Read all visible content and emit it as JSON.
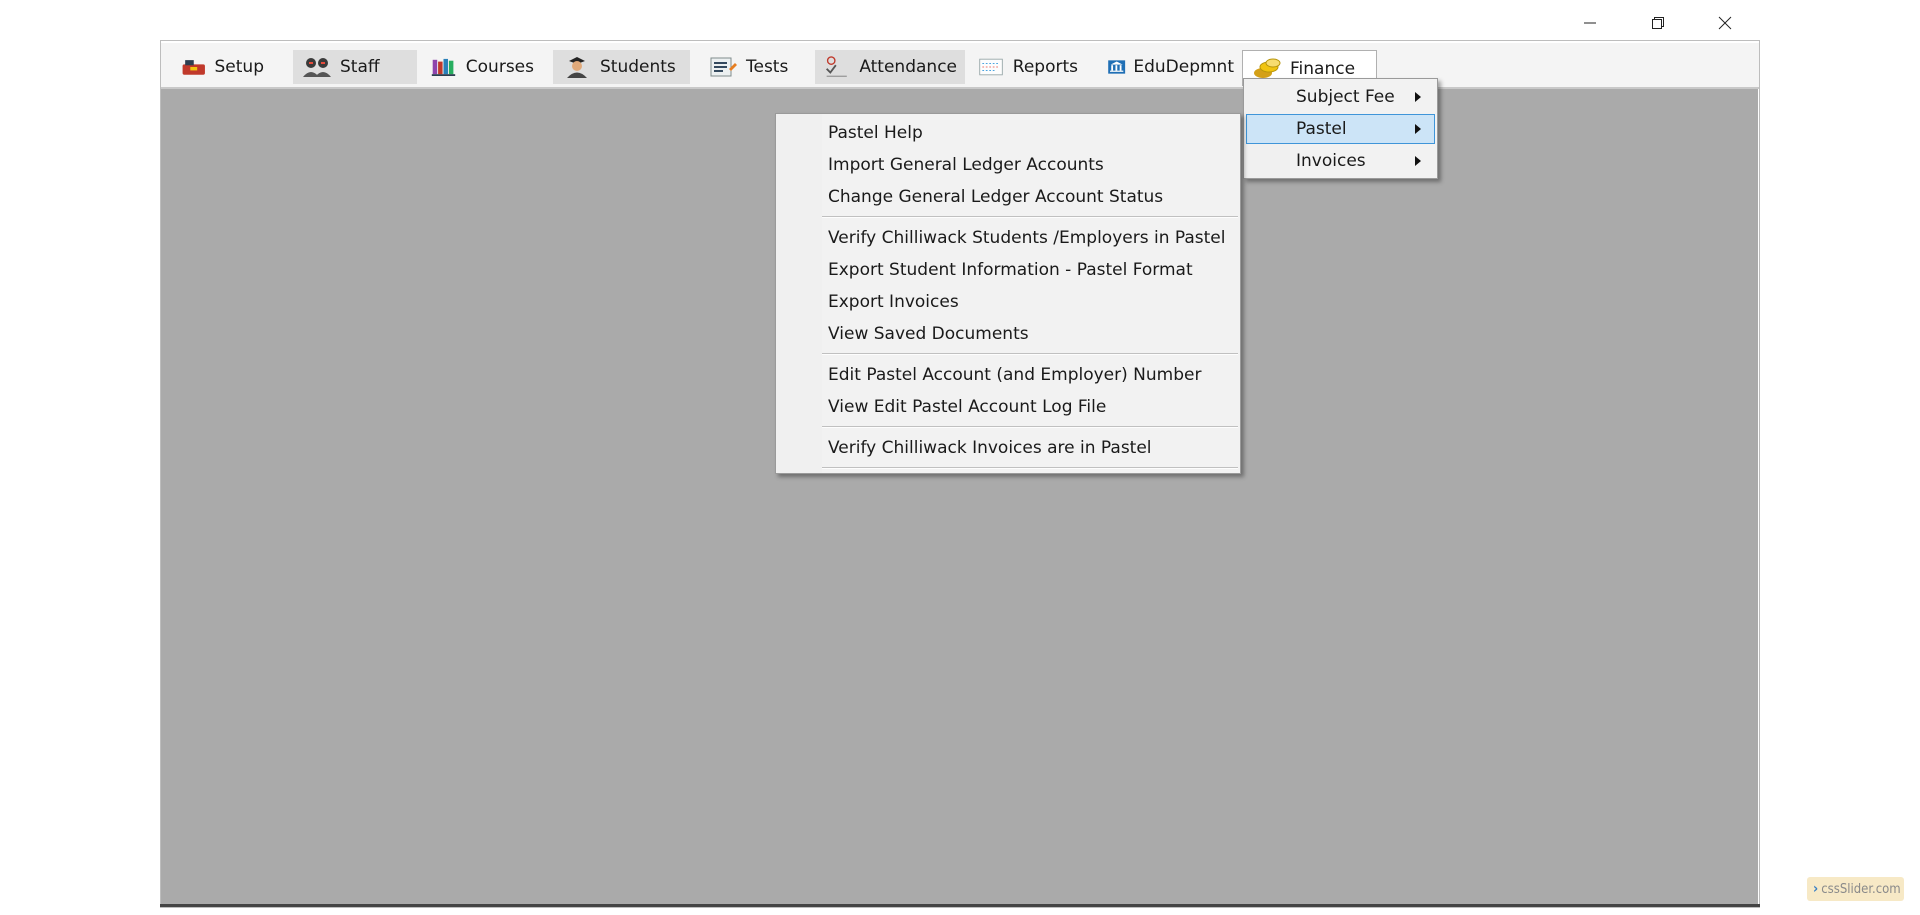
{
  "window": {
    "controls": [
      "minimize-icon",
      "restore-icon",
      "close-icon"
    ]
  },
  "menubar": {
    "items": [
      {
        "label": "Setup",
        "icon": "toolbox-icon"
      },
      {
        "label": "Staff",
        "icon": "people-icon"
      },
      {
        "label": "Courses",
        "icon": "books-icon"
      },
      {
        "label": "Students",
        "icon": "student-icon"
      },
      {
        "label": "Tests",
        "icon": "test-sheet-icon"
      },
      {
        "label": "Attendance",
        "icon": "attendance-icon"
      },
      {
        "label": "Reports",
        "icon": "report-icon"
      },
      {
        "label": "EduDepmnt",
        "icon": "building-icon"
      },
      {
        "label": "Finance",
        "icon": "coins-icon"
      }
    ],
    "open_menu": "Finance"
  },
  "finance_menu": {
    "items": [
      {
        "label": "Subject Fee",
        "has_submenu": true
      },
      {
        "label": "Pastel",
        "has_submenu": true,
        "selected": true
      },
      {
        "label": "Invoices",
        "has_submenu": true
      }
    ]
  },
  "pastel_menu": {
    "groups": [
      [
        "Pastel Help",
        "Import General Ledger Accounts",
        "Change General Ledger Account Status"
      ],
      [
        "Verify Chilliwack Students /Employers in Pastel",
        "Export Student Information - Pastel Format",
        "Export Invoices",
        "View Saved Documents"
      ],
      [
        "Edit Pastel Account (and Employer) Number",
        "View Edit Pastel Account Log File"
      ],
      [
        "Verify Chilliwack Invoices are in Pastel"
      ]
    ]
  },
  "watermark": {
    "text": "cssSlider.com",
    "icon": "chevron-right-icon"
  },
  "colors": {
    "workspace": "#aaaaaa",
    "menubar": "#f4f4f4",
    "selection_bg": "#cce4f7",
    "selection_border": "#3f95d9"
  }
}
